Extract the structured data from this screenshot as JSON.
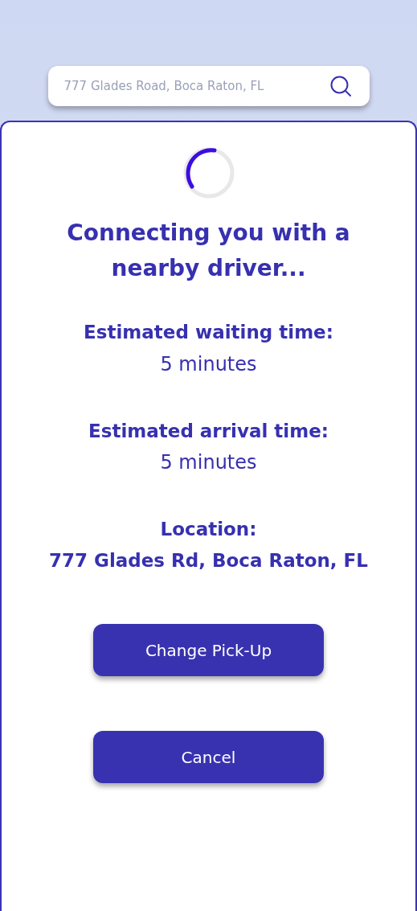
{
  "search": {
    "placeholder": "777 Glades Road, Boca Raton, FL"
  },
  "title": "Connecting you with a nearby driver...",
  "details": [
    {
      "label": "Estimated waiting time:",
      "value": "5 minutes",
      "kind": "plain"
    },
    {
      "label": "Estimated arrival time:",
      "value": "5 minutes",
      "kind": "plain"
    },
    {
      "label": "Location:",
      "value": "777 Glades Rd, Boca Raton, FL",
      "kind": "bold"
    }
  ],
  "buttons": [
    "Change Pick-Up",
    "Cancel"
  ]
}
